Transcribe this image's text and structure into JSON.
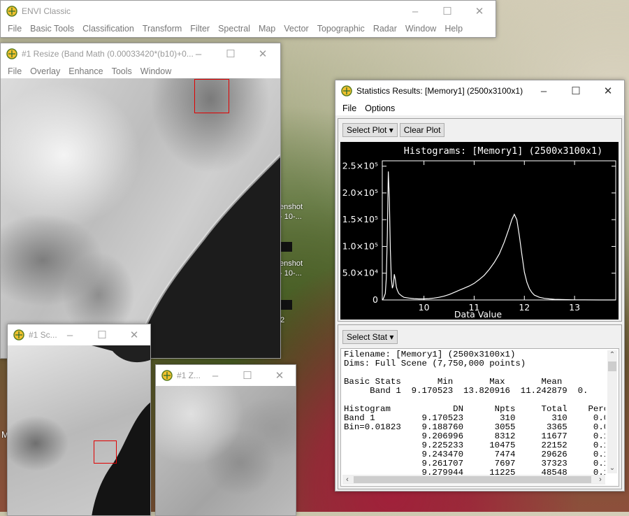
{
  "desktop": {
    "icon_labels": [
      "enshot",
      "- 10-...",
      "enshot",
      "- 10-...",
      "2"
    ],
    "left_label": "M"
  },
  "envi_main": {
    "title": "ENVI Classic",
    "menu": [
      "File",
      "Basic Tools",
      "Classification",
      "Transform",
      "Filter",
      "Spectral",
      "Map",
      "Vector",
      "Topographic",
      "Radar",
      "Window",
      "Help"
    ]
  },
  "image_window": {
    "title": "#1 Resize (Band Math (0.00033420*(b10)+0...",
    "menu": [
      "File",
      "Overlay",
      "Enhance",
      "Tools",
      "Window"
    ]
  },
  "scroll_window": {
    "title": "#1 Sc..."
  },
  "zoom_window": {
    "title": "#1 Z..."
  },
  "stats_window": {
    "title": "Statistics Results: [Memory1] (2500x3100x1)",
    "menu": [
      "File",
      "Options"
    ],
    "select_plot": "Select Plot",
    "clear_plot": "Clear Plot",
    "select_stat": "Select Stat",
    "text_lines": [
      "Filename: [Memory1] (2500x3100x1)",
      "Dims: Full Scene (7,750,000 points)",
      "",
      "Basic Stats       Min       Max       Mean",
      "     Band 1  9.170523  13.820916  11.242879  0.",
      "",
      "Histogram            DN      Npts     Total    Perc",
      "Band 1         9.170523       310       310     0.0",
      "Bin=0.01823    9.188760      3055      3365     0.0",
      "               9.206996      8312     11677     0.1",
      "               9.225233     10475     22152     0.1",
      "               9.243470      7474     29626     0.1",
      "               9.261707      7697     37323     0.1",
      "               9.279944     11225     48548     0.1"
    ]
  },
  "chart_data": {
    "type": "line",
    "title": "Histograms: [Memory1] (2500x3100x1)",
    "xlabel": "Data Value",
    "ylabel": "",
    "xlim": [
      9.17,
      13.82
    ],
    "ylim": [
      0,
      260000
    ],
    "x_ticks": [
      10,
      11,
      12,
      13
    ],
    "y_ticks": [
      {
        "value": 0,
        "label": "0"
      },
      {
        "value": 50000,
        "label": "5.0×10⁴"
      },
      {
        "value": 100000,
        "label": "1.0×10⁵"
      },
      {
        "value": 150000,
        "label": "1.5×10⁵"
      },
      {
        "value": 200000,
        "label": "2.0×10⁵"
      },
      {
        "value": 250000,
        "label": "2.5×10⁵"
      }
    ],
    "background": "#000000",
    "line_color": "#ffffff",
    "series": [
      {
        "x": [
          9.17,
          9.19,
          9.21,
          9.23,
          9.25,
          9.27,
          9.29,
          9.31,
          9.33,
          9.35,
          9.37,
          9.39,
          9.41,
          9.43,
          9.45,
          9.47,
          9.5,
          9.55,
          9.6,
          9.7,
          9.8,
          9.9,
          10.0,
          10.1,
          10.2,
          10.3,
          10.4,
          10.5,
          10.6,
          10.7,
          10.8,
          10.9,
          11.0,
          11.1,
          11.2,
          11.3,
          11.4,
          11.5,
          11.6,
          11.7,
          11.75,
          11.8,
          11.85,
          11.9,
          11.95,
          12.0,
          12.05,
          12.1,
          12.15,
          12.2,
          12.3,
          12.4,
          12.5,
          12.6,
          12.8,
          13.0,
          13.2,
          13.5,
          13.82
        ],
        "y": [
          500,
          2000,
          7000,
          12000,
          40000,
          120000,
          240000,
          190000,
          95000,
          40000,
          22000,
          28000,
          48000,
          38000,
          24000,
          18000,
          12000,
          8000,
          5000,
          3500,
          2500,
          2000,
          2000,
          2500,
          3500,
          5000,
          7000,
          10000,
          14000,
          18000,
          22000,
          26000,
          31000,
          38000,
          46000,
          57000,
          70000,
          86000,
          108000,
          135000,
          150000,
          160000,
          150000,
          120000,
          85000,
          52000,
          33000,
          21000,
          14000,
          9000,
          5000,
          3000,
          2000,
          1200,
          600,
          300,
          150,
          50,
          0
        ]
      }
    ]
  }
}
